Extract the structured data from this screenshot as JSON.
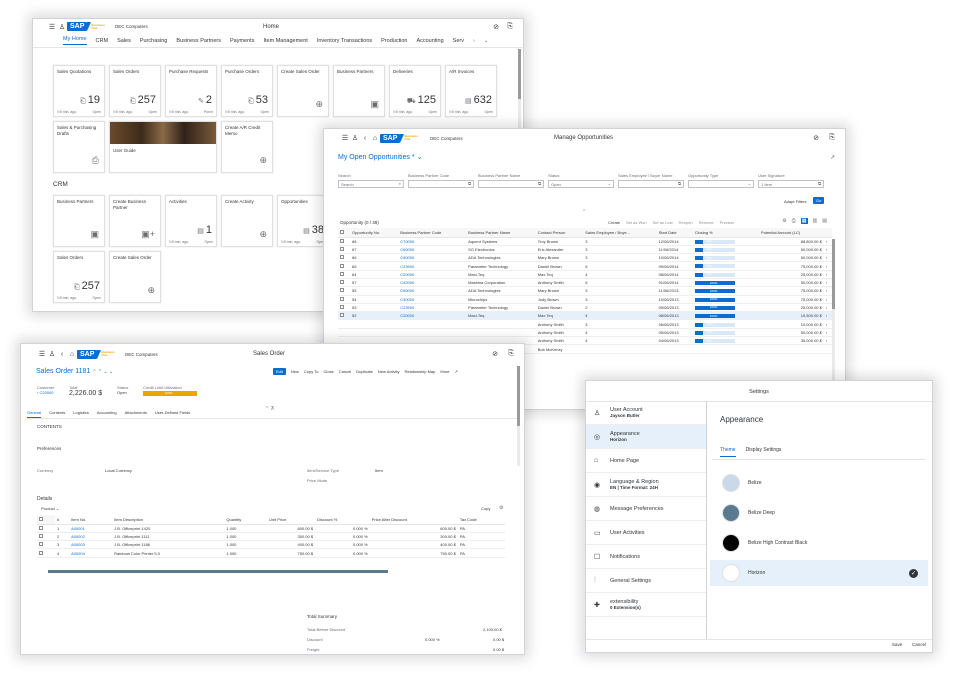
{
  "home": {
    "company": "OEC Computers",
    "title": "Home",
    "tabs": [
      "My Home",
      "CRM",
      "Sales",
      "Purchasing",
      "Business Partners",
      "Payments",
      "Item Management",
      "Inventory Transactions",
      "Production",
      "Accounting",
      "Serv"
    ],
    "tiles_row1": [
      {
        "title": "Sales Quotations",
        "value": "19",
        "age": "5 min. ago",
        "status": "Open"
      },
      {
        "title": "Sales Orders",
        "value": "257",
        "age": "5 min. ago",
        "status": "Open"
      },
      {
        "title": "Purchase Requests",
        "value": "2",
        "age": "5 min. ago",
        "status": "Purch"
      },
      {
        "title": "Purchase Orders",
        "value": "53",
        "age": "5 min. ago",
        "status": "Open"
      },
      {
        "title": "Create Sales Order",
        "value": "",
        "age": "",
        "status": ""
      },
      {
        "title": "Business Partners",
        "value": "",
        "age": "",
        "status": ""
      },
      {
        "title": "Deliveries",
        "value": "125",
        "age": "5 min. ago",
        "status": "Open"
      },
      {
        "title": "A/R Invoices",
        "value": "632",
        "age": "5 min. ago",
        "status": "Open"
      }
    ],
    "tiles_row2": [
      {
        "title": "Sales & Purchasing Drafts"
      },
      {
        "title": "User Guide"
      },
      {
        "title": "Create A/R Credit Memo"
      }
    ],
    "crm_label": "CRM",
    "crm_tiles": [
      {
        "title": "Business Partners",
        "value": "",
        "age": "",
        "status": ""
      },
      {
        "title": "Create Business Partner",
        "value": "",
        "age": "",
        "status": ""
      },
      {
        "title": "Activities",
        "value": "1",
        "age": "5 min. ago",
        "status": "Open"
      },
      {
        "title": "Create Activity",
        "value": "",
        "age": "",
        "status": ""
      },
      {
        "title": "Opportunities",
        "value": "38",
        "age": "5 min. ago",
        "status": "Open"
      }
    ],
    "crm_tiles_row2": [
      {
        "title": "Sales Orders",
        "value": "257",
        "age": "5 min. ago",
        "status": "Open"
      },
      {
        "title": "Create Sales Order",
        "value": "",
        "age": "",
        "status": ""
      }
    ]
  },
  "opps": {
    "company": "OEC Computers",
    "title": "Manage Opportunities",
    "variant": "My Open Opportunities *",
    "filters": [
      {
        "label": "Search",
        "value": "Search"
      },
      {
        "label": "Business Partner Code",
        "value": ""
      },
      {
        "label": "Business Partner Name",
        "value": ""
      },
      {
        "label": "Status",
        "value": "Open"
      },
      {
        "label": "Sales Employee / Buyer Name",
        "value": ""
      },
      {
        "label": "Opportunity Type",
        "value": ""
      },
      {
        "label": "User Signature",
        "value": "1 Item"
      }
    ],
    "adapt_filters": "Adapt Filters",
    "go": "Go",
    "count_label": "Opportunity (0 / 38)",
    "toolbar": [
      "Create",
      "Set as Won",
      "Set as Lost",
      "Reopen",
      "Remove",
      "Preview"
    ],
    "columns": [
      "Opportunity No.",
      "Business Partner Code",
      "Business Partner Name",
      "Contact Person",
      "Sales Employee / Buye...",
      "Start Date",
      "Closing %",
      "Potential Amount (LC)"
    ],
    "rows": [
      {
        "no": "68",
        "code": "C70000",
        "name": "Aquent Systems",
        "contact": "Troy Brown",
        "emp": "3",
        "date": "12/06/2014",
        "closing": 20,
        "closing_label": "20%",
        "amount": "88,800.00 $"
      },
      {
        "no": "67",
        "code": "C60000",
        "name": "SG Electronics",
        "contact": "Eric Alexander",
        "emp": "3",
        "date": "11/06/2014",
        "closing": 20,
        "closing_label": "20%",
        "amount": "50,000.00 $"
      },
      {
        "no": "66",
        "code": "C50000",
        "name": "ADA Technologies",
        "contact": "Mary Brown",
        "emp": "3",
        "date": "10/06/2014",
        "closing": 20,
        "closing_label": "20%",
        "amount": "50,000.00 $"
      },
      {
        "no": "65",
        "code": "C23900",
        "name": "Parameter Technology",
        "contact": "Daniel Brown",
        "emp": "5",
        "date": "09/06/2014",
        "closing": 20,
        "closing_label": "20%",
        "amount": "75,000.00 $"
      },
      {
        "no": "64",
        "code": "C20000",
        "name": "Maxi-Teq",
        "contact": "Max Teq",
        "emp": "4",
        "date": "08/06/2014",
        "closing": 20,
        "closing_label": "20%",
        "amount": "25,000.00 $"
      },
      {
        "no": "57",
        "code": "C42000",
        "name": "Mashina Corporation",
        "contact": "Anthony Smith",
        "emp": "5",
        "date": "01/06/2014",
        "closing": 100,
        "closing_label": "100%",
        "amount": "50,000.00 $"
      },
      {
        "no": "55",
        "code": "C50000",
        "name": "ADA Technologies",
        "contact": "Mary Brown",
        "emp": "3",
        "date": "11/06/2013",
        "closing": 100,
        "closing_label": "100%",
        "amount": "75,000.00 $"
      },
      {
        "no": "54",
        "code": "C30000",
        "name": "Microchips",
        "contact": "Judy Brown",
        "emp": "3",
        "date": "10/06/2013",
        "closing": 100,
        "closing_label": "100%",
        "amount": "75,000.00 $"
      },
      {
        "no": "53",
        "code": "C23900",
        "name": "Parameter Technology",
        "contact": "Daniel Brown",
        "emp": "2",
        "date": "09/06/2013",
        "closing": 100,
        "closing_label": "100%",
        "amount": "25,000.00 $"
      },
      {
        "no": "52",
        "code": "C20000",
        "name": "Maxi-Teq",
        "contact": "Max Teq",
        "emp": "4",
        "date": "08/06/2013",
        "closing": 100,
        "closing_label": "100%",
        "amount": "10,500.00 $"
      },
      {
        "no": "",
        "code": "",
        "name": "",
        "contact": "Anthony Smith",
        "emp": "3",
        "date": "06/06/2013",
        "closing": 20,
        "closing_label": "20%",
        "amount": "10,000.00 $"
      },
      {
        "no": "",
        "code": "",
        "name": "",
        "contact": "Anthony Smith",
        "emp": "4",
        "date": "05/06/2013",
        "closing": 20,
        "closing_label": "20%",
        "amount": "50,000.00 $"
      },
      {
        "no": "",
        "code": "",
        "name": "",
        "contact": "Anthony Smith",
        "emp": "4",
        "date": "04/06/2013",
        "closing": 20,
        "closing_label": "20%",
        "amount": "35,000.00 $"
      },
      {
        "no": "",
        "code": "",
        "name": "",
        "contact": "Bob McKenzy",
        "emp": "",
        "date": "",
        "closing": 0,
        "closing_label": "",
        "amount": ""
      }
    ]
  },
  "so": {
    "company": "OEC Computers",
    "title": "Sales Order",
    "doc_title": "Sales Order 1181",
    "actions": [
      "Edit",
      "New",
      "Copy To",
      "Close",
      "Cancel",
      "Duplicate",
      "New Activity",
      "Relationship Map",
      "More"
    ],
    "customer_label": "Customer",
    "customer": "C20000",
    "total_label": "Total",
    "total": "2,226.00 $",
    "status_label": "Status",
    "status": "Open",
    "credit_label": "Credit Limit Utilization",
    "credit": 100,
    "credit_text": "100%",
    "tabs": [
      "General",
      "Contents",
      "Logistics",
      "Accounting",
      "Attachments",
      "User-Defined Fields"
    ],
    "contents": "CONTENTS",
    "preferences": "Preferences",
    "currency_label": "Currency",
    "currency": "Local Currency",
    "item_type_label": "Item/Service Type",
    "item_type": "Item",
    "price_mode": "Price Mode",
    "details": "Details",
    "product": "Product",
    "copy": "Copy",
    "columns": [
      "#",
      "Item No.",
      "Item Description",
      "Quantity",
      "Unit Price",
      "Discount %",
      "Price After Discount",
      "Tax Code"
    ],
    "lines": [
      {
        "n": "1",
        "item": "A00001",
        "desc": "J.B. Officeprint 1420",
        "qty": "1.000",
        "price": "600.00 $",
        "disc": "0.000 %",
        "after": "600.00 $",
        "tax": "PA"
      },
      {
        "n": "2",
        "item": "A00002",
        "desc": "J.B. Officeprint 1111",
        "qty": "1.000",
        "price": "300.00 $",
        "disc": "0.000 %",
        "after": "300.00 $",
        "tax": "PA"
      },
      {
        "n": "3",
        "item": "A00003",
        "desc": "J.B. Officeprint 1186",
        "qty": "1.000",
        "price": "400.00 $",
        "disc": "0.000 %",
        "after": "400.00 $",
        "tax": "PA"
      },
      {
        "n": "4",
        "item": "A00004",
        "desc": "Rainbow Color Printer 5.0",
        "qty": "1.000",
        "price": "750.00 $",
        "disc": "0.000 %",
        "after": "750.00 $",
        "tax": "PA"
      }
    ],
    "summary_title": "Total Summary",
    "total_before_label": "Total Before Discount",
    "total_before": "2,100.00 $",
    "discount_label": "Discount",
    "discount_pct": "0.000 %",
    "discount": "0.00 $",
    "freight_label": "Freight",
    "freight": "0.00 $"
  },
  "settings": {
    "title": "Settings",
    "items": [
      {
        "label": "User Account",
        "sub": "Jayson Butler",
        "icon": "user-icon"
      },
      {
        "label": "Appearance",
        "sub": "Horizon",
        "icon": "palette-icon"
      },
      {
        "label": "Home Page",
        "sub": "",
        "icon": "home-icon"
      },
      {
        "label": "Language & Region",
        "sub": "EN | Time Format: 24H",
        "icon": "globe-icon"
      },
      {
        "label": "Message Preferences",
        "sub": "",
        "icon": "message-icon"
      },
      {
        "label": "User Activities",
        "sub": "",
        "icon": "laptop-icon"
      },
      {
        "label": "Notifications",
        "sub": "",
        "icon": "bell-icon"
      },
      {
        "label": "General Settings",
        "sub": "",
        "icon": "sliders-icon"
      },
      {
        "label": "extensibility",
        "sub": "0 Extension(s)",
        "icon": "puzzle-icon"
      }
    ],
    "panel_title": "Appearance",
    "tabs": [
      "Theme",
      "Display Settings"
    ],
    "themes": [
      {
        "name": "Belize",
        "color": "#c9d9ea"
      },
      {
        "name": "Belize Deep",
        "color": "#5a7a8f"
      },
      {
        "name": "Belize High Contrast Black",
        "color": "#000000"
      },
      {
        "name": "Horizon",
        "color": "#ffffff"
      }
    ],
    "save": "Save",
    "cancel": "Cancel"
  }
}
